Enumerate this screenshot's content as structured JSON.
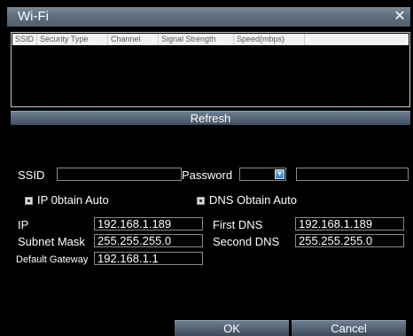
{
  "window": {
    "title": "Wi-Fi",
    "close_icon": "✕"
  },
  "list": {
    "columns": [
      "SSID",
      "Security Type",
      "Channel",
      "Signal Strength",
      "Speed(mbps)"
    ]
  },
  "refresh_label": "Refresh",
  "ssid": {
    "label": "SSID",
    "value": ""
  },
  "password": {
    "label": "Password",
    "value": ""
  },
  "ip_obtain_auto": {
    "label": "IP 0btain Auto"
  },
  "dns_obtain_auto": {
    "label": "DNS Obtain Auto"
  },
  "network": {
    "ip_label": "IP",
    "ip": "192.168.1.189",
    "subnet_label": "Subnet Mask",
    "subnet": "255.255.255.0",
    "gateway_label": "Default Gateway",
    "gateway": "192.168.1.1",
    "first_dns_label": "First DNS",
    "first_dns": "192.168.1.189",
    "second_dns_label": "Second DNS",
    "second_dns": "255.255.255.0"
  },
  "buttons": {
    "ok": "OK",
    "cancel": "Cancel"
  }
}
